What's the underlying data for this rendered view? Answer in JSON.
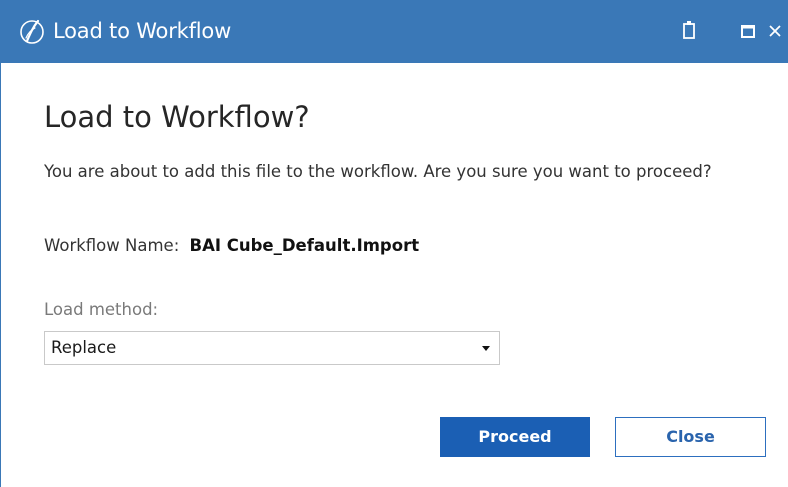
{
  "window": {
    "title": "Load to Workflow",
    "icons": {
      "app": "onestream-logo-icon",
      "copy": "copy-icon",
      "maximize": "maximize-icon",
      "close": "close-icon"
    },
    "titlebar_color": "#3a78b7"
  },
  "dialog": {
    "heading": "Load to Workflow?",
    "message": "You are about to add this file to the workflow. Are you sure you want to proceed?",
    "workflow_label": "Workflow Name:",
    "workflow_value": "BAI Cube_Default.Import",
    "load_method_label": "Load method:",
    "load_method_selected": "Replace"
  },
  "buttons": {
    "proceed": "Proceed",
    "close": "Close"
  },
  "colors": {
    "accent": "#1b5fb4",
    "close_border": "#2d6fbf"
  }
}
